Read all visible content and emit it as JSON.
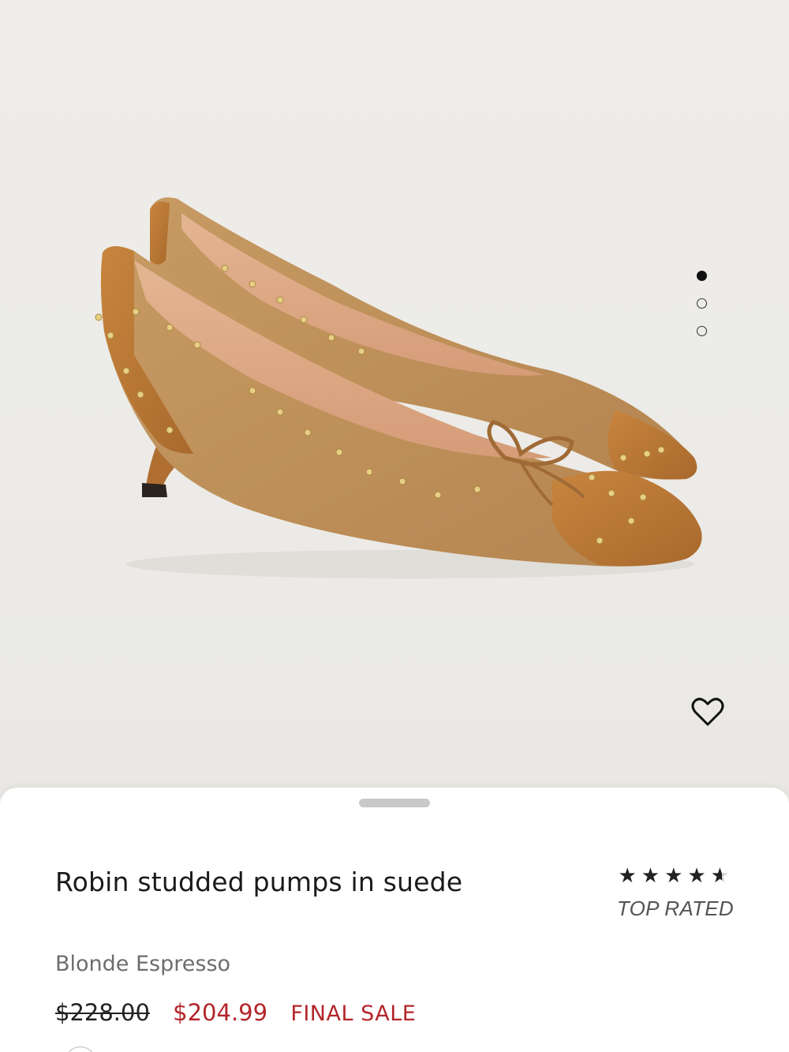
{
  "product": {
    "title": "Robin studded pumps in suede",
    "color_name": "Blonde Espresso",
    "price_original": "$228.00",
    "price_sale": "$204.99",
    "sale_badge": "FINAL SALE",
    "rating": {
      "value": 4.5,
      "max": 5,
      "label": "TOP RATED"
    }
  },
  "gallery": {
    "image_count": 3,
    "active_index": 0,
    "favorite_icon": "heart-outline-icon"
  },
  "colors": {
    "sale": "#b3262b",
    "background": "#efeeeb",
    "sheet": "#ffffff",
    "text": "#1a1a1a"
  }
}
